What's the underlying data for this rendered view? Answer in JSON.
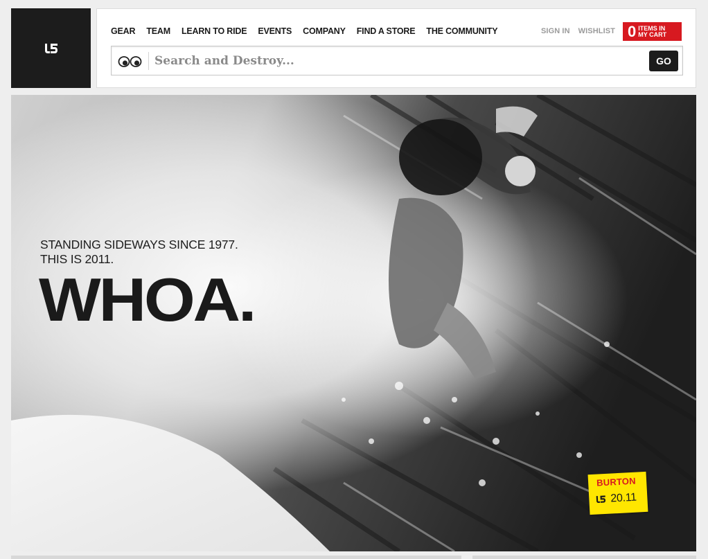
{
  "brand": {
    "logo_icon": "burton-logo-icon"
  },
  "nav": {
    "items": [
      {
        "label": "GEAR"
      },
      {
        "label": "TEAM"
      },
      {
        "label": "LEARN TO RIDE"
      },
      {
        "label": "EVENTS"
      },
      {
        "label": "COMPANY"
      },
      {
        "label": "FIND A STORE"
      },
      {
        "label": "THE COMMUNITY"
      }
    ]
  },
  "account": {
    "sign_in": "SIGN IN",
    "wishlist": "WISHLIST"
  },
  "cart": {
    "count": "0",
    "label": "ITEMS IN MY CART",
    "color": "#d71920"
  },
  "search": {
    "placeholder": "Search and Destroy...",
    "go_label": "GO",
    "icon": "eyes-icon"
  },
  "hero": {
    "tagline_line1": "STANDING SIDEWAYS SINCE 1977.",
    "tagline_line2": "THIS IS 2011.",
    "headline": "WHOA.",
    "sticker": {
      "brand": "BURTON",
      "date": "20.11",
      "bg_color": "#ffe600",
      "brand_color": "#d71920"
    }
  }
}
